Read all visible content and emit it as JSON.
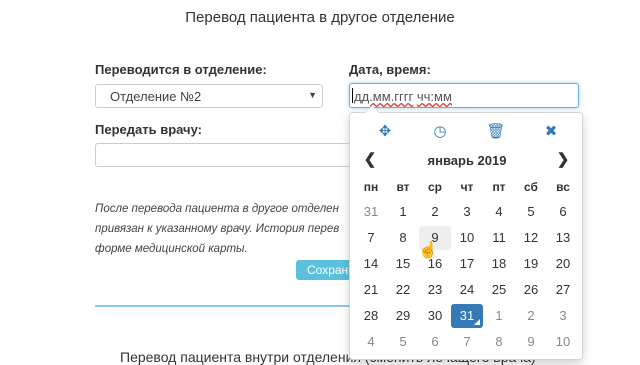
{
  "page": {
    "title": "Перевод пациента в другое отделение",
    "department_label": "Переводится в отделение:",
    "department_value": "Отделение №2",
    "datetime_label": "Дата, время:",
    "datetime_placeholder_date": "дд.мм.гггг",
    "datetime_placeholder_time": "чч:мм",
    "doctor_label": "Передать врачу:",
    "doctor_value": "",
    "info_lines": [
      "После перевода пациента в другое отделен",
      "привязан к указанному врачу. История перев",
      "форме медицинской карты."
    ],
    "save_label": "Сохранить",
    "bottom_text": "Перевод пациента внутри отделения (сменить лечащего врача)"
  },
  "picker": {
    "tools": [
      {
        "name": "move-icon",
        "glyph": "✥"
      },
      {
        "name": "clock-icon",
        "glyph": "◷"
      },
      {
        "name": "trash-icon",
        "glyph": "🗑"
      },
      {
        "name": "close-icon",
        "glyph": "✖"
      }
    ],
    "prev_glyph": "❮",
    "next_glyph": "❯",
    "month_label": "январь 2019",
    "weekdays": [
      "пн",
      "вт",
      "ср",
      "чт",
      "пт",
      "сб",
      "вс"
    ],
    "weeks": [
      [
        {
          "d": "31",
          "o": true
        },
        {
          "d": "1"
        },
        {
          "d": "2"
        },
        {
          "d": "3"
        },
        {
          "d": "4"
        },
        {
          "d": "5"
        },
        {
          "d": "6"
        }
      ],
      [
        {
          "d": "7"
        },
        {
          "d": "8"
        },
        {
          "d": "9",
          "h": true
        },
        {
          "d": "10"
        },
        {
          "d": "11"
        },
        {
          "d": "12"
        },
        {
          "d": "13"
        }
      ],
      [
        {
          "d": "14"
        },
        {
          "d": "15"
        },
        {
          "d": "16"
        },
        {
          "d": "17"
        },
        {
          "d": "18"
        },
        {
          "d": "19"
        },
        {
          "d": "20"
        }
      ],
      [
        {
          "d": "21"
        },
        {
          "d": "22"
        },
        {
          "d": "23"
        },
        {
          "d": "24"
        },
        {
          "d": "25"
        },
        {
          "d": "26"
        },
        {
          "d": "27"
        }
      ],
      [
        {
          "d": "28"
        },
        {
          "d": "29"
        },
        {
          "d": "30"
        },
        {
          "d": "31",
          "t": true
        },
        {
          "d": "1",
          "o": true
        },
        {
          "d": "2",
          "o": true
        },
        {
          "d": "3",
          "o": true
        }
      ],
      [
        {
          "d": "4",
          "o": true
        },
        {
          "d": "5",
          "o": true
        },
        {
          "d": "6",
          "o": true
        },
        {
          "d": "7",
          "o": true
        },
        {
          "d": "8",
          "o": true
        },
        {
          "d": "9",
          "o": true
        },
        {
          "d": "10",
          "o": true
        }
      ]
    ],
    "accent_color": "#337ab7"
  }
}
